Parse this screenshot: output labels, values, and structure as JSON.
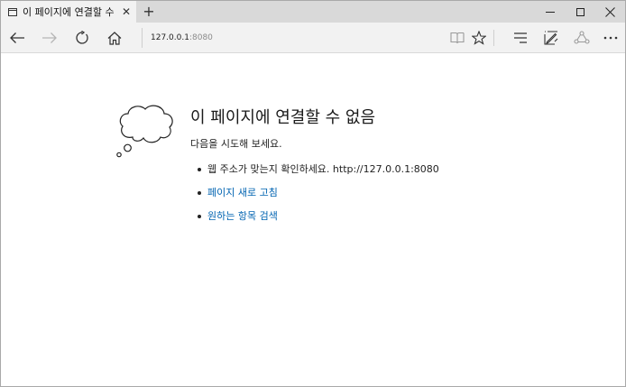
{
  "tab": {
    "title": "이 페이지에 연결할 수",
    "close_glyph": "✕",
    "new_tab_glyph": "+"
  },
  "address_bar": {
    "host": "127.0.0.1",
    "port": ":8080"
  },
  "error_page": {
    "heading": "이 페이지에 연결할 수 없음",
    "subheading": "다음을 시도해 보세요.",
    "suggestion_check_address": "웹 주소가 맞는지 확인하세요. http://127.0.0.1:8080",
    "suggestion_refresh": "페이지 새로 고침",
    "suggestion_search": "원하는 항목 검색"
  },
  "colors": {
    "link": "#0063b1",
    "tab_strip": "#d9d9d9",
    "toolbar": "#f2f2f2"
  },
  "icons": [
    "back-icon",
    "forward-icon",
    "refresh-icon",
    "home-icon",
    "reading-view-icon",
    "favorite-star-icon",
    "hub-icon",
    "web-note-icon",
    "share-icon",
    "more-icon",
    "thought-cloud-icon"
  ]
}
